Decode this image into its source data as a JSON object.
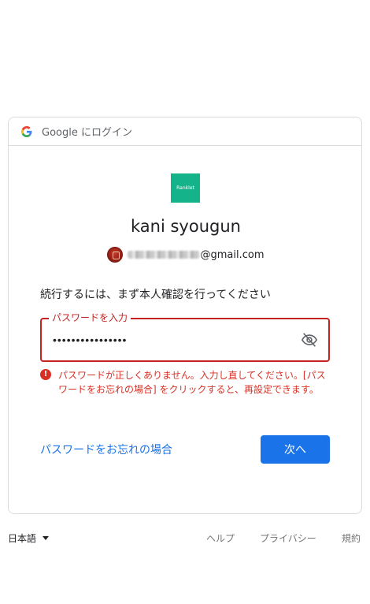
{
  "header": {
    "title": "Google にログイン"
  },
  "app": {
    "logo_text": "Ranklet",
    "logo_color": "#14b38a"
  },
  "user": {
    "name": "kani syougun",
    "email_domain": "@gmail.com"
  },
  "instruction": "続行するには、まず本人確認を行ってください",
  "password_field": {
    "label": "パスワードを入力",
    "value": "••••••••••••••••"
  },
  "error": {
    "icon": "!",
    "message": "パスワードが正しくありません。入力し直してください。[パスワードをお忘れの場合] をクリックすると、再設定できます。"
  },
  "actions": {
    "forgot_label": "パスワードをお忘れの場合",
    "next_label": "次へ"
  },
  "footer": {
    "language": "日本語",
    "help": "ヘルプ",
    "privacy": "プライバシー",
    "terms": "規約"
  },
  "colors": {
    "accent": "#1a73e8",
    "error": "#d93025",
    "border": "#dadce0"
  }
}
